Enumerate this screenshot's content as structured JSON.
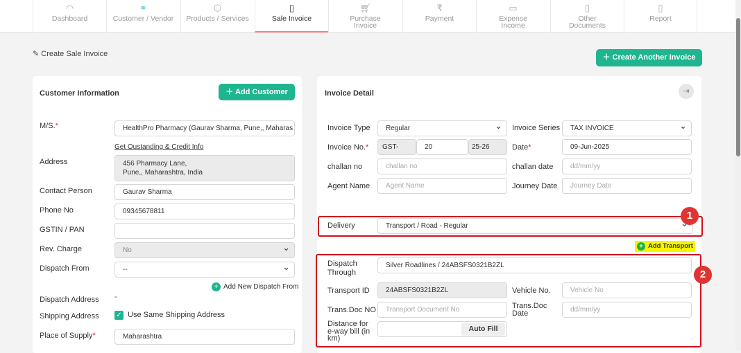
{
  "nav": {
    "tabs": [
      {
        "label": "Dashboard",
        "icon": "gauge-icon"
      },
      {
        "label": "Customer / Vendor",
        "icon": "users-icon"
      },
      {
        "label": "Products / Services",
        "icon": "box-icon"
      },
      {
        "label": "Sale Invoice",
        "icon": "invoice-icon",
        "active": true
      },
      {
        "label": "Purchase Invoice",
        "icon": "cart-icon"
      },
      {
        "label": "Payment",
        "icon": "payment-icon"
      },
      {
        "label": "Expense Income",
        "icon": "expense-icon"
      },
      {
        "label": "Other Documents",
        "icon": "document-icon"
      },
      {
        "label": "Report",
        "icon": "clipboard-icon"
      }
    ]
  },
  "page": {
    "title": "Create Sale Invoice",
    "create_another": "Create Another Invoice"
  },
  "customer": {
    "heading": "Customer Information",
    "add_customer": "Add Customer",
    "ms_label": "M/S.",
    "ms_value": "HealthPro Pharmacy (Gaurav Sharma, Pune,, Maharas",
    "outstanding_link": "Get Oustanding & Credit Info",
    "address_label": "Address",
    "address_line1": "456 Pharmacy Lane,",
    "address_line2": "Pune,, Maharashtra, India",
    "contact_label": "Contact Person",
    "contact_value": "Gaurav Sharma",
    "phone_label": "Phone No",
    "phone_value": "09345678811",
    "gstin_label": "GSTIN / PAN",
    "gstin_value": "",
    "rev_label": "Rev. Charge",
    "rev_value": "No",
    "dispatch_from_label": "Dispatch From",
    "dispatch_from_value": "--",
    "add_dispatch": "Add New Dispatch From",
    "dispatch_address_label": "Dispatch Address",
    "dispatch_address_value": "-",
    "shipping_label": "Shipping Address",
    "shipping_checkbox": "Use Same Shipping Address",
    "supply_label": "Place of Supply",
    "supply_value": "Maharashtra"
  },
  "invoice": {
    "heading": "Invoice Detail",
    "type_label": "Invoice Type",
    "type_value": "Regular",
    "series_label": "Invoice Series",
    "series_value": "TAX INVOICE",
    "no_label": "Invoice No.",
    "no_prefix": "GST-",
    "no_value": "20",
    "no_suffix": "25-26",
    "date_label": "Date",
    "date_value": "09-Jun-2025",
    "challan_label": "challan no",
    "challan_ph": "challan no",
    "challan_date_label": "challan date",
    "challan_date_ph": "dd/mm/yy",
    "agent_label": "Agent Name",
    "agent_ph": "Agent Name",
    "journey_label": "Journey Date",
    "journey_ph": "Journey Date",
    "delivery_label": "Delivery",
    "delivery_value": "Transport / Road - Regular",
    "add_transport": "Add Transport",
    "dispatch_through_label": "Dispatch Through",
    "dispatch_through_value": "Silver Roadlines / 24ABSFS0321B2ZL",
    "transport_id_label": "Transport ID",
    "transport_id_value": "24ABSFS0321B2ZL",
    "vehicle_label": "Vehicle No.",
    "vehicle_ph": "Vehicle No",
    "transdoc_label": "Trans.Doc NO",
    "transdoc_ph": "Transport Document No",
    "transdoc_date_label": "Trans.Doc Date",
    "transdoc_date_ph": "dd/mm/yy",
    "distance_label": "Distance for e-way bill (in km)",
    "autofill": "Auto Fill"
  },
  "annotations": {
    "one": "1",
    "two": "2"
  }
}
